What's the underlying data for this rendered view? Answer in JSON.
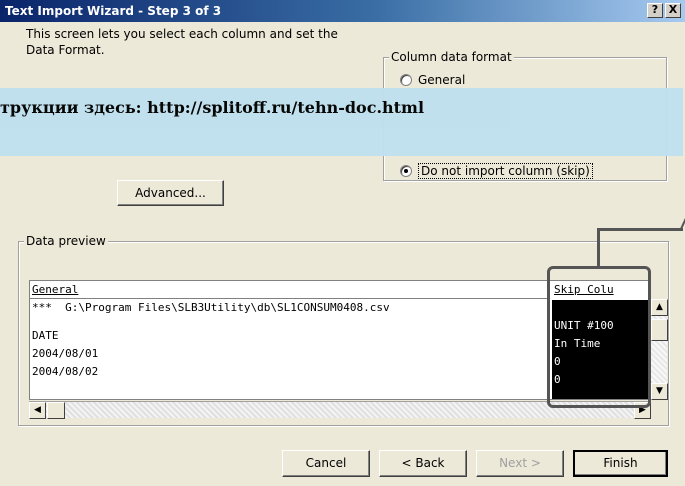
{
  "window": {
    "title": "Text Import Wizard - Step 3 of 3",
    "help_label": "?",
    "close_label": "X"
  },
  "description": "This screen lets you select each column and set the Data Format.",
  "column_format": {
    "group_label": "Column data format",
    "options": [
      {
        "label": "General",
        "selected": false
      },
      {
        "label": "Do not import column (skip)",
        "selected": true
      }
    ]
  },
  "banner_text": "трукции здесь: http://splitoff.ru/tehn-doc.html",
  "advanced_label": "Advanced...",
  "data_preview": {
    "group_label": "Data preview",
    "header_general": "General",
    "header_skip": "Skip Colu",
    "rows": [
      "***  G:\\Program Files\\SLB3Utility\\db\\SL1CONSUM0408.csv",
      "",
      "DATE",
      "2004/08/01",
      "2004/08/02"
    ],
    "skip_rows": [
      "",
      "UNIT #100",
      "In Time",
      "0",
      "0"
    ]
  },
  "buttons": {
    "cancel": "Cancel",
    "back": "< Back",
    "next": "Next >",
    "finish": "Finish"
  }
}
